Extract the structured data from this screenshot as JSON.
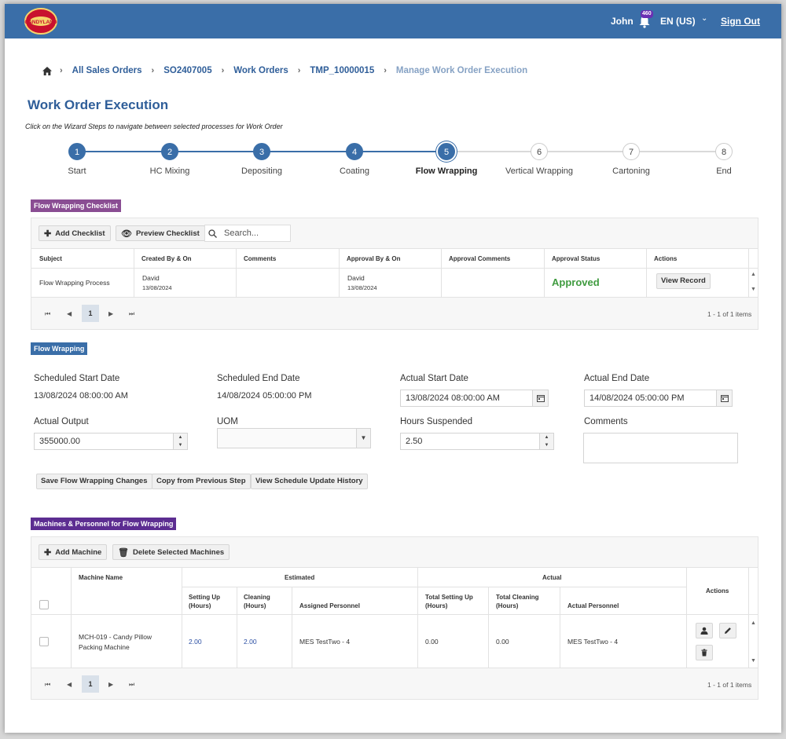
{
  "header": {
    "user": "John",
    "notification_count": "460",
    "language": "EN (US)",
    "sign_out": "Sign Out",
    "logo_text": "CANDYLAND"
  },
  "breadcrumb": [
    "All Sales Orders",
    "SO2407005",
    "Work Orders",
    "TMP_10000015",
    "Manage Work Order Execution"
  ],
  "page_title": "Work Order Execution",
  "hint": "Click on the Wizard Steps to navigate between selected processes for Work Order",
  "wizard": {
    "current": 5,
    "steps": [
      {
        "num": "1",
        "label": "Start"
      },
      {
        "num": "2",
        "label": "HC Mixing"
      },
      {
        "num": "3",
        "label": "Depositing"
      },
      {
        "num": "4",
        "label": "Coating"
      },
      {
        "num": "5",
        "label": "Flow Wrapping"
      },
      {
        "num": "6",
        "label": "Vertical Wrapping"
      },
      {
        "num": "7",
        "label": "Cartoning"
      },
      {
        "num": "8",
        "label": "End"
      }
    ]
  },
  "checklist": {
    "tag": "Flow Wrapping Checklist",
    "add_label": "Add Checklist",
    "preview_label": "Preview Checklist",
    "search_placeholder": "Search...",
    "columns": [
      "Subject",
      "Created By & On",
      "Comments",
      "Approval By & On",
      "Approval Comments",
      "Approval Status",
      "Actions"
    ],
    "row": {
      "subject": "Flow Wrapping Process",
      "created_by": "David",
      "created_on": "13/08/2024",
      "comments": "",
      "approval_by": "David",
      "approval_on": "13/08/2024",
      "approval_comments": "",
      "status": "Approved",
      "action": "View Record"
    },
    "page": "1",
    "items_info": "1 - 1 of 1 items"
  },
  "flow_wrapping": {
    "tag": "Flow Wrapping",
    "scheduled_start_label": "Scheduled Start Date",
    "scheduled_start": "13/08/2024 08:00:00 AM",
    "scheduled_end_label": "Scheduled End Date",
    "scheduled_end": "14/08/2024 05:00:00 PM",
    "actual_start_label": "Actual Start Date",
    "actual_start": "13/08/2024 08:00:00 AM",
    "actual_end_label": "Actual End Date",
    "actual_end": "14/08/2024 05:00:00 PM",
    "actual_output_label": "Actual Output",
    "actual_output": "355000.00",
    "uom_label": "UOM",
    "uom": "",
    "hours_suspended_label": "Hours Suspended",
    "hours_suspended": "2.50",
    "comments_label": "Comments",
    "comments": "",
    "buttons": {
      "save": "Save Flow Wrapping Changes",
      "copy": "Copy from Previous Step",
      "history": "View Schedule Update History"
    }
  },
  "machines": {
    "tag": "Machines & Personnel for Flow Wrapping",
    "add_label": "Add Machine",
    "delete_label": "Delete Selected Machines",
    "headers": {
      "machine_name": "Machine Name",
      "estimated": "Estimated",
      "actual": "Actual",
      "actions": "Actions",
      "setting_up": "Setting Up (Hours)",
      "cleaning": "Cleaning (Hours)",
      "assigned_personnel": "Assigned Personnel",
      "total_setting_up": "Total Setting Up (Hours)",
      "total_cleaning": "Total Cleaning (Hours)",
      "actual_personnel": "Actual Personnel"
    },
    "row": {
      "machine_name": "MCH-019 - Candy Pillow Packing Machine",
      "setting_up": "2.00",
      "cleaning": "2.00",
      "assigned_personnel": "MES TestTwo - 4",
      "total_setting_up": "0.00",
      "total_cleaning": "0.00",
      "actual_personnel": "MES TestTwo - 4"
    },
    "page": "1",
    "items_info": "1 - 1 of 1 items"
  }
}
